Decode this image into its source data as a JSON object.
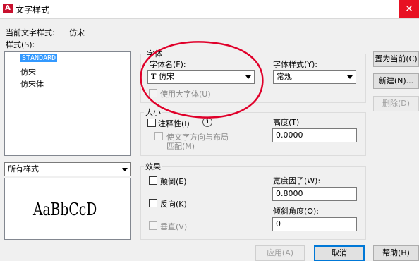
{
  "window": {
    "title": "文字样式",
    "app_icon": "A",
    "close_glyph": "✕"
  },
  "current_style": {
    "label": "当前文字样式:",
    "value": "仿宋"
  },
  "styles": {
    "label": "样式(S):",
    "items": [
      "STANDARD",
      "仿宋",
      "仿宋体"
    ],
    "selected": "STANDARD",
    "filter_value": "所有样式"
  },
  "preview": {
    "text": "AaBbCcD"
  },
  "font": {
    "group_label": "字体",
    "name_label": "字体名(F):",
    "name_value": "仿宋",
    "name_icon": "truetype-font-icon",
    "style_label": "字体样式(Y):",
    "style_value": "常规",
    "bigfont_label": "使用大字体(U)"
  },
  "size": {
    "group_label": "大小",
    "annotative_label": "注释性(I)",
    "info_glyph": "i",
    "orient_label_1": "使文字方向与布局",
    "orient_label_2": "匹配(M)",
    "height_label": "高度(T)",
    "height_value": "0.0000"
  },
  "effects": {
    "group_label": "效果",
    "upside_down_label": "颠倒(E)",
    "backwards_label": "反向(K)",
    "vertical_label": "垂直(V)",
    "width_factor_label": "宽度因子(W):",
    "width_factor_value": "0.8000",
    "oblique_label": "倾斜角度(O):",
    "oblique_value": "0"
  },
  "buttons": {
    "set_current": "置为当前(C)",
    "new": "新建(N)...",
    "delete": "删除(D)",
    "apply": "应用(A)",
    "cancel": "取消",
    "help": "帮助(H)"
  },
  "colors": {
    "selection": "#3399ff",
    "annotation_red": "#e0002a",
    "default_button_border": "#0078d7"
  }
}
